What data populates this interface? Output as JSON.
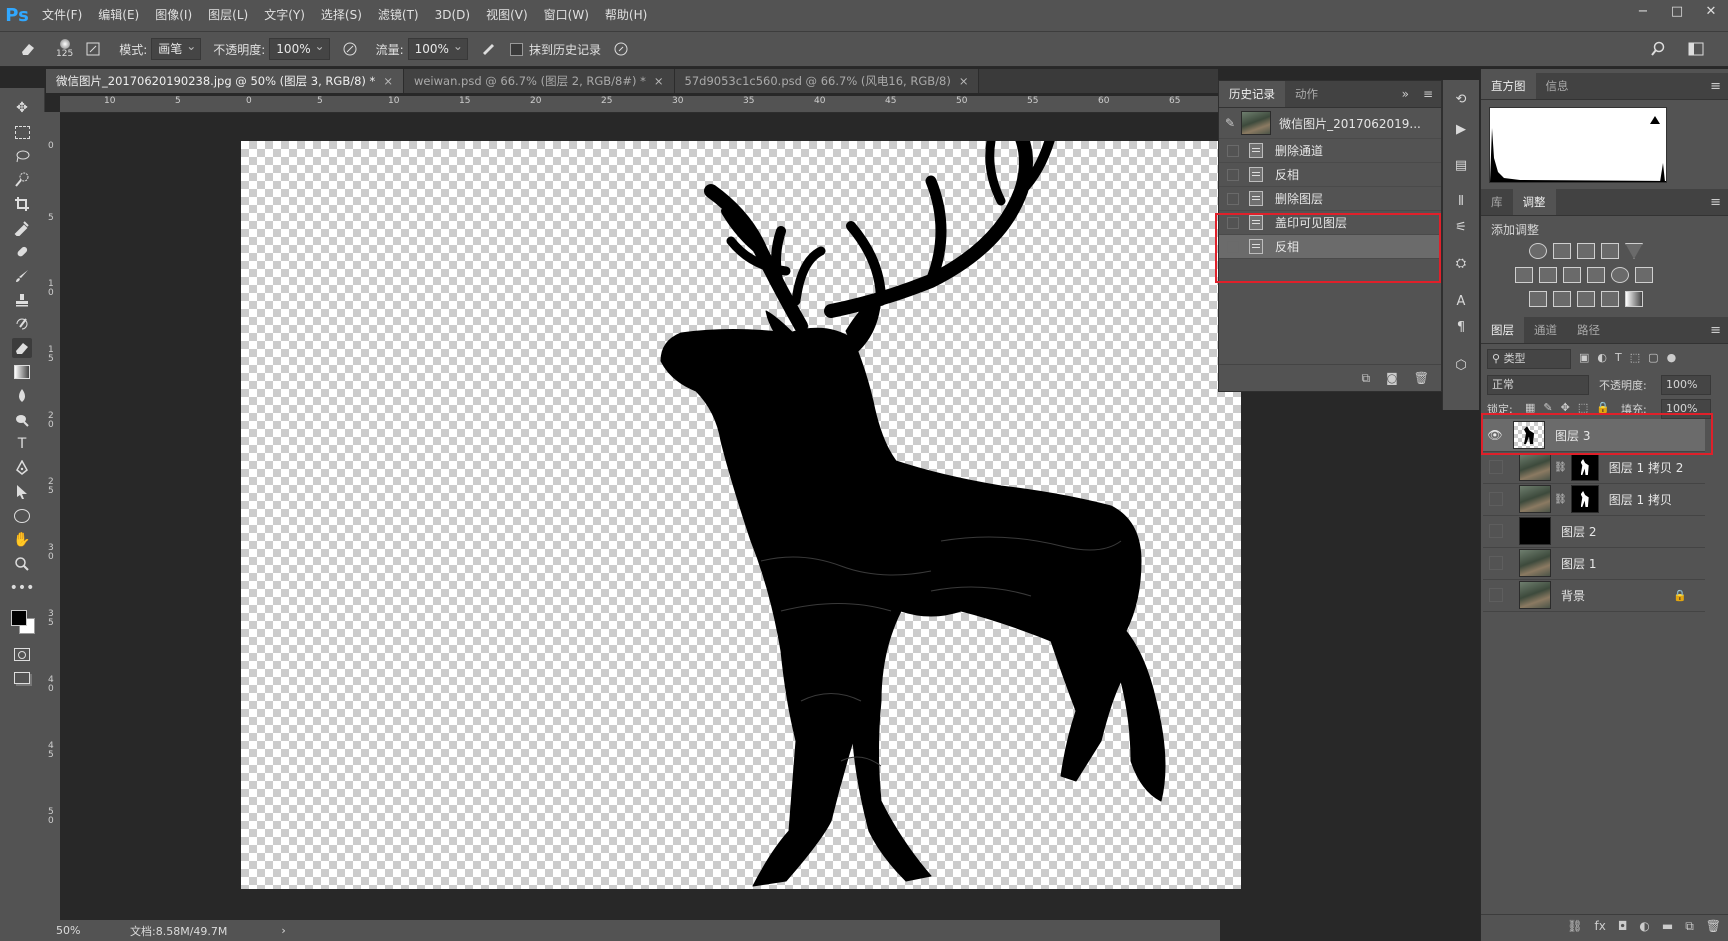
{
  "app": {
    "logo": "Ps"
  },
  "menu": [
    "文件(F)",
    "编辑(E)",
    "图像(I)",
    "图层(L)",
    "文字(Y)",
    "选择(S)",
    "滤镜(T)",
    "3D(D)",
    "视图(V)",
    "窗口(W)",
    "帮助(H)"
  ],
  "window_controls": {
    "minimize": "−",
    "maximize": "□",
    "close": "✕"
  },
  "options": {
    "brush_size": "125",
    "mode_label": "模式:",
    "mode_value": "画笔",
    "opacity_label": "不透明度:",
    "opacity_value": "100%",
    "flow_label": "流量:",
    "flow_value": "100%",
    "erase_history_label": "抹到历史记录"
  },
  "tabs": [
    {
      "label": "微信图片_20170620190238.jpg @ 50% (图层 3, RGB/8) *",
      "close": "×"
    },
    {
      "label": "weiwan.psd @ 66.7% (图层 2, RGB/8#) *",
      "close": "×"
    },
    {
      "label": "57d9053c1c560.psd @ 66.7% (风电16, RGB/8)",
      "close": "×"
    }
  ],
  "ruler": {
    "top_ticks": [
      "10",
      "5",
      "0",
      "5",
      "10",
      "15",
      "20",
      "25",
      "30",
      "35",
      "40",
      "45",
      "50",
      "55",
      "60",
      "65"
    ],
    "left_ticks": [
      "0",
      "5",
      "1\n0",
      "1\n5",
      "2\n0",
      "2\n5",
      "3\n0",
      "3\n5",
      "4\n0",
      "4\n5",
      "5\n0"
    ]
  },
  "status": {
    "zoom": "50%",
    "doc": "文档:8.58M/49.7M",
    "arrow": "›"
  },
  "history": {
    "tabs": [
      "历史记录",
      "动作"
    ],
    "snapshot": "微信图片_2017062019...",
    "items": [
      "删除通道",
      "反相",
      "删除图层",
      "盖印可见图层",
      "反相"
    ],
    "selected_index": 4
  },
  "dock": {
    "top_tabs": [
      "直方图",
      "信息"
    ],
    "adj_tabs": [
      "库",
      "调整"
    ],
    "adj_title": "添加调整",
    "layer_tabs": [
      "图层",
      "通道",
      "路径"
    ],
    "filter_label": "类型",
    "blend_mode": "正常",
    "opacity_label": "不透明度:",
    "opacity_value": "100%",
    "lock_label": "锁定:",
    "fill_label": "填充:",
    "fill_value": "100%"
  },
  "layers": [
    {
      "name": "图层 3",
      "visible": true,
      "selected": true
    },
    {
      "name": "图层 1 拷贝 2",
      "visible": false
    },
    {
      "name": "图层 1 拷贝",
      "visible": false
    },
    {
      "name": "图层 2",
      "visible": false
    },
    {
      "name": "图层 1",
      "visible": false
    },
    {
      "name": "背景",
      "visible": false,
      "locked": true
    }
  ],
  "colors": {
    "highlight_red": "#e0202a",
    "ps_blue": "#31a8ff"
  }
}
